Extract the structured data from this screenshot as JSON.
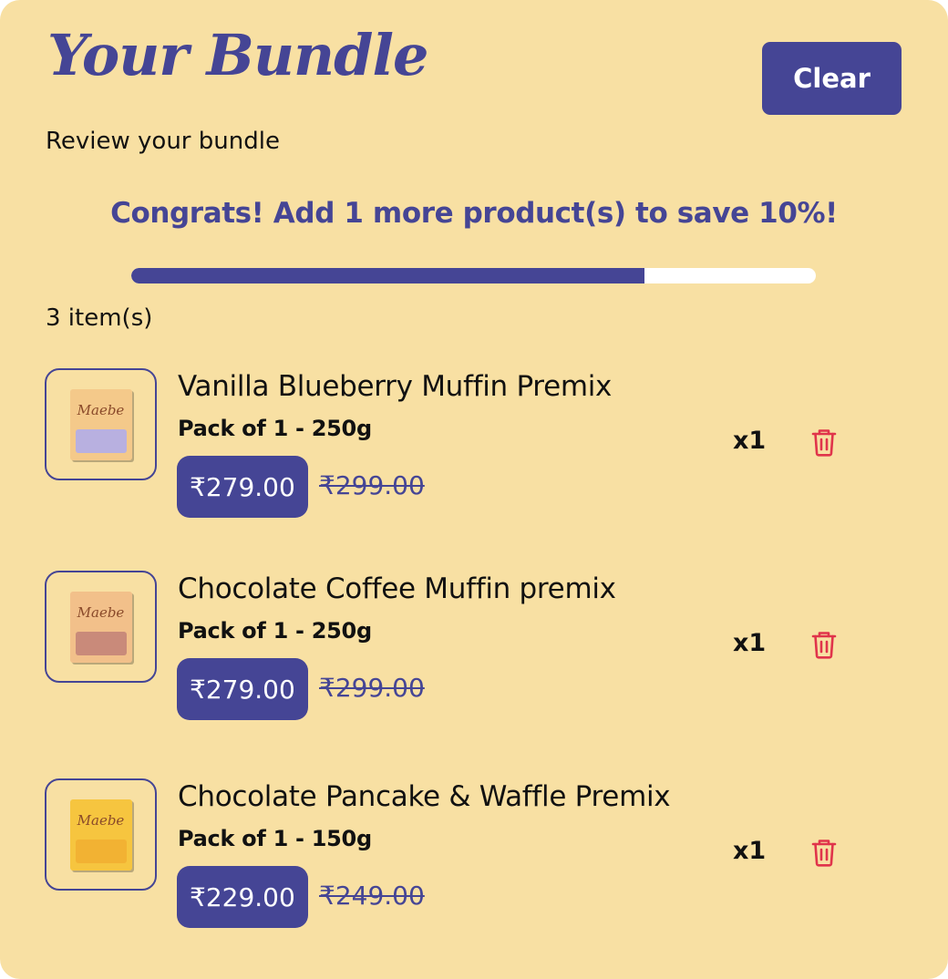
{
  "header": {
    "title": "Your Bundle",
    "clear_label": "Clear",
    "subtitle": "Review your bundle"
  },
  "promo": {
    "message": "Congrats! Add 1 more product(s) to save 10%!",
    "progress_fraction": 0.75
  },
  "cart": {
    "count_label": "3 item(s)",
    "items": [
      {
        "name": "Vanilla Blueberry Muffin Premix",
        "variant": "Pack of 1 - 250g",
        "price": "₹279.00",
        "compare_price": "₹299.00",
        "quantity": "x1",
        "pack_color": "#b8b0e0",
        "box_color": "#f4c98a"
      },
      {
        "name": "Chocolate Coffee Muffin premix",
        "variant": "Pack of 1 - 250g",
        "price": "₹279.00",
        "compare_price": "₹299.00",
        "quantity": "x1",
        "pack_color": "#c98a7a",
        "box_color": "#f2c08a"
      },
      {
        "name": "Chocolate Pancake & Waffle Premix",
        "variant": "Pack of 1 - 150g",
        "price": "₹229.00",
        "compare_price": "₹249.00",
        "quantity": "x1",
        "pack_color": "#f2b233",
        "box_color": "#f6c53f"
      }
    ]
  },
  "icons": {
    "remove": "trash-icon"
  },
  "colors": {
    "background": "#f8e0a3",
    "accent": "#454595",
    "danger": "#e0344b"
  }
}
